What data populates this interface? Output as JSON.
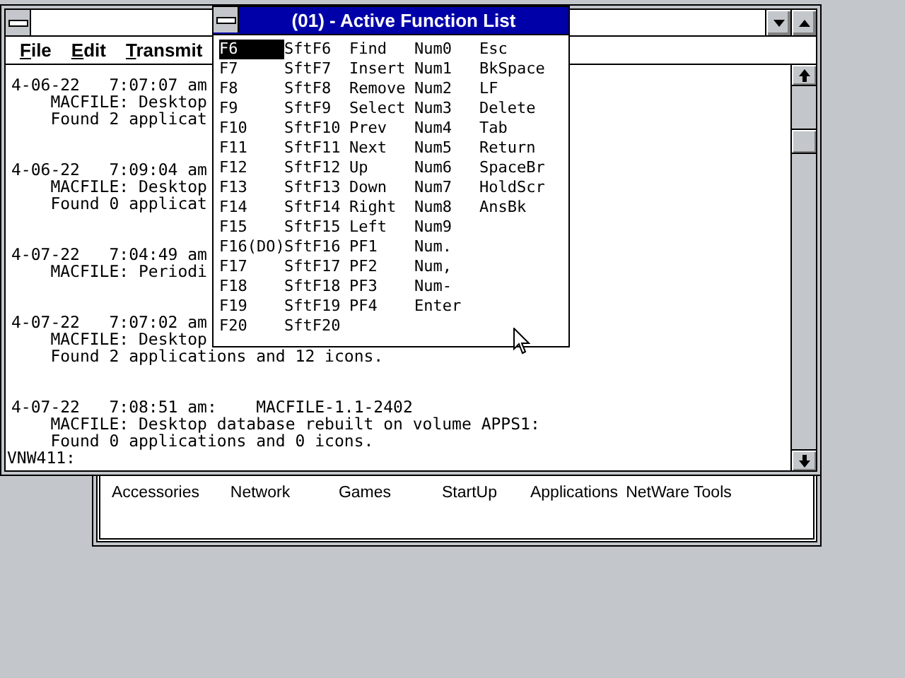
{
  "program_group": {
    "items": [
      {
        "label": "Accessories"
      },
      {
        "label": "Network"
      },
      {
        "label": "Games"
      },
      {
        "label": "StartUp"
      },
      {
        "label": "Applications"
      },
      {
        "label": "NetWare Tools"
      }
    ]
  },
  "terminal": {
    "menu": [
      {
        "label": "File"
      },
      {
        "label": "Edit"
      },
      {
        "label": "Transmit"
      }
    ],
    "log_entries": [
      {
        "lines": [
          "4-06-22   7:07:07 am",
          "    MACFILE: Desktop",
          "    Found 2 applicat"
        ]
      },
      {
        "lines": [
          "4-06-22   7:09:04 am",
          "    MACFILE: Desktop",
          "    Found 0 applicat"
        ]
      },
      {
        "lines": [
          "4-07-22   7:04:49 am",
          "    MACFILE: Periodi"
        ]
      },
      {
        "lines": [
          "4-07-22   7:07:02 am",
          "    MACFILE: Desktop",
          "    Found 2 applications and 12 icons."
        ]
      },
      {
        "lines": [
          "4-07-22   7:08:51 am:    MACFILE-1.1-2402",
          "    MACFILE: Desktop database rebuilt on volume APPS1:",
          "    Found 0 applications and 0 icons."
        ]
      }
    ],
    "prompt": "VNW411:"
  },
  "function_list": {
    "title": "(01) - Active Function List",
    "columns": [
      [
        {
          "label": "F6",
          "selected": true
        },
        {
          "label": "F7",
          "selected": false
        },
        {
          "label": "F8",
          "selected": false
        },
        {
          "label": "F9",
          "selected": false
        },
        {
          "label": "F10",
          "selected": false
        },
        {
          "label": "F11",
          "selected": false
        },
        {
          "label": "F12",
          "selected": false
        },
        {
          "label": "F13",
          "selected": false
        },
        {
          "label": "F14",
          "selected": false
        },
        {
          "label": "F15",
          "selected": false
        },
        {
          "label": "F16(DO)",
          "selected": false
        },
        {
          "label": "F17",
          "selected": false
        },
        {
          "label": "F18",
          "selected": false
        },
        {
          "label": "F19",
          "selected": false
        },
        {
          "label": "F20",
          "selected": false
        }
      ],
      [
        {
          "label": "SftF6",
          "selected": false
        },
        {
          "label": "SftF7",
          "selected": false
        },
        {
          "label": "SftF8",
          "selected": false
        },
        {
          "label": "SftF9",
          "selected": false
        },
        {
          "label": "SftF10",
          "selected": false
        },
        {
          "label": "SftF11",
          "selected": false
        },
        {
          "label": "SftF12",
          "selected": false
        },
        {
          "label": "SftF13",
          "selected": false
        },
        {
          "label": "SftF14",
          "selected": false
        },
        {
          "label": "SftF15",
          "selected": false
        },
        {
          "label": "SftF16",
          "selected": false
        },
        {
          "label": "SftF17",
          "selected": false
        },
        {
          "label": "SftF18",
          "selected": false
        },
        {
          "label": "SftF19",
          "selected": false
        },
        {
          "label": "SftF20",
          "selected": false
        }
      ],
      [
        {
          "label": "Find",
          "selected": false
        },
        {
          "label": "Insert",
          "selected": false
        },
        {
          "label": "Remove",
          "selected": false
        },
        {
          "label": "Select",
          "selected": false
        },
        {
          "label": "Prev",
          "selected": false
        },
        {
          "label": "Next",
          "selected": false
        },
        {
          "label": "Up",
          "selected": false
        },
        {
          "label": "Down",
          "selected": false
        },
        {
          "label": "Right",
          "selected": false
        },
        {
          "label": "Left",
          "selected": false
        },
        {
          "label": "PF1",
          "selected": false
        },
        {
          "label": "PF2",
          "selected": false
        },
        {
          "label": "PF3",
          "selected": false
        },
        {
          "label": "PF4",
          "selected": false
        }
      ],
      [
        {
          "label": "Num0",
          "selected": false
        },
        {
          "label": "Num1",
          "selected": false
        },
        {
          "label": "Num2",
          "selected": false
        },
        {
          "label": "Num3",
          "selected": false
        },
        {
          "label": "Num4",
          "selected": false
        },
        {
          "label": "Num5",
          "selected": false
        },
        {
          "label": "Num6",
          "selected": false
        },
        {
          "label": "Num7",
          "selected": false
        },
        {
          "label": "Num8",
          "selected": false
        },
        {
          "label": "Num9",
          "selected": false
        },
        {
          "label": "Num.",
          "selected": false
        },
        {
          "label": "Num,",
          "selected": false
        },
        {
          "label": "Num-",
          "selected": false
        },
        {
          "label": "Enter",
          "selected": false
        }
      ],
      [
        {
          "label": "Esc",
          "selected": false
        },
        {
          "label": "BkSpace",
          "selected": false
        },
        {
          "label": "LF",
          "selected": false
        },
        {
          "label": "Delete",
          "selected": false
        },
        {
          "label": "Tab",
          "selected": false
        },
        {
          "label": "Return",
          "selected": false
        },
        {
          "label": "SpaceBr",
          "selected": false
        },
        {
          "label": "HoldScr",
          "selected": false
        },
        {
          "label": "AnsBk",
          "selected": false
        }
      ]
    ]
  }
}
